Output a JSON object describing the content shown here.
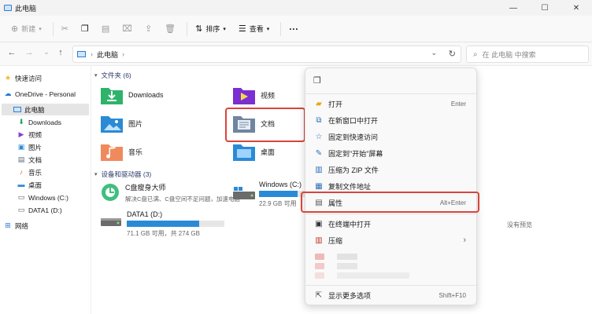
{
  "window": {
    "title": "此电脑",
    "minimize": "—",
    "maximize": "☐",
    "close": "✕"
  },
  "toolbar": {
    "new": "新建",
    "sort": "排序",
    "view": "查看",
    "more": "···"
  },
  "nav": {
    "back": "←",
    "forward": "→",
    "up": "↑",
    "separator": "›",
    "path": "此电脑",
    "search_placeholder": "在 此电脑 中搜索"
  },
  "sidebar": {
    "items": [
      {
        "label": "快速访问",
        "icon": "star-icon"
      },
      {
        "label": "OneDrive - Personal",
        "icon": "cloud-icon"
      },
      {
        "label": "此电脑",
        "icon": "computer-icon"
      },
      {
        "label": "Downloads",
        "icon": "download-icon"
      },
      {
        "label": "视频",
        "icon": "video-icon"
      },
      {
        "label": "图片",
        "icon": "picture-icon"
      },
      {
        "label": "文档",
        "icon": "document-icon"
      },
      {
        "label": "音乐",
        "icon": "music-icon"
      },
      {
        "label": "桌面",
        "icon": "desktop-icon"
      },
      {
        "label": "Windows (C:)",
        "icon": "drive-icon"
      },
      {
        "label": "DATA1 (D:)",
        "icon": "drive-icon"
      },
      {
        "label": "网络",
        "icon": "network-icon"
      }
    ]
  },
  "content": {
    "folders_header": "文件夹 (6)",
    "folders": [
      {
        "label": "Downloads",
        "icon": "download-folder-icon"
      },
      {
        "label": "视频",
        "icon": "video-folder-icon"
      },
      {
        "label": "图片",
        "icon": "picture-folder-icon"
      },
      {
        "label": "文档",
        "icon": "document-folder-icon"
      },
      {
        "label": "音乐",
        "icon": "music-folder-icon"
      },
      {
        "label": "桌面",
        "icon": "desktop-folder-icon"
      }
    ],
    "devices_header": "设备和驱动器 (3)",
    "devices": [
      {
        "name": "C盘瘦身大师",
        "sub": "解决C盘已满、C盘空间不足问题，加速电脑",
        "icon": "cleaner-icon"
      },
      {
        "name": "Windows (C:)",
        "sub": "22.9 GB 可用",
        "used_fraction": 0.84,
        "icon": "windows-drive-icon"
      },
      {
        "name": "DATA1 (D:)",
        "sub": "71.1 GB 可用，共 274 GB",
        "used_fraction": 0.74,
        "icon": "data-drive-icon"
      }
    ],
    "empty_note": "没有预览"
  },
  "context_menu": {
    "top_icon": "copy-icon",
    "items": [
      {
        "label": "打开",
        "shortcut": "Enter",
        "icon": "folder-open-icon"
      },
      {
        "label": "在新窗口中打开",
        "shortcut": "",
        "icon": "new-window-icon"
      },
      {
        "label": "固定到快速访问",
        "shortcut": "",
        "icon": "star-icon"
      },
      {
        "label": "固定到\"开始\"屏幕",
        "shortcut": "",
        "icon": "pin-icon"
      },
      {
        "label": "压缩为 ZIP 文件",
        "shortcut": "",
        "icon": "zip-icon"
      },
      {
        "label": "复制文件地址",
        "shortcut": "",
        "icon": "copy-path-icon"
      },
      {
        "label": "属性",
        "shortcut": "Alt+Enter",
        "icon": "properties-icon"
      },
      {
        "label": "在终端中打开",
        "shortcut": "",
        "icon": "terminal-icon"
      },
      {
        "label": "压缩",
        "shortcut": "›",
        "icon": "compress-icon"
      },
      {
        "label": "显示更多选项",
        "shortcut": "Shift+F10",
        "icon": "more-options-icon"
      }
    ]
  },
  "colors": {
    "accent": "#2b8ad6",
    "highlight": "#d9443b",
    "selection": "#e5e5e5"
  }
}
